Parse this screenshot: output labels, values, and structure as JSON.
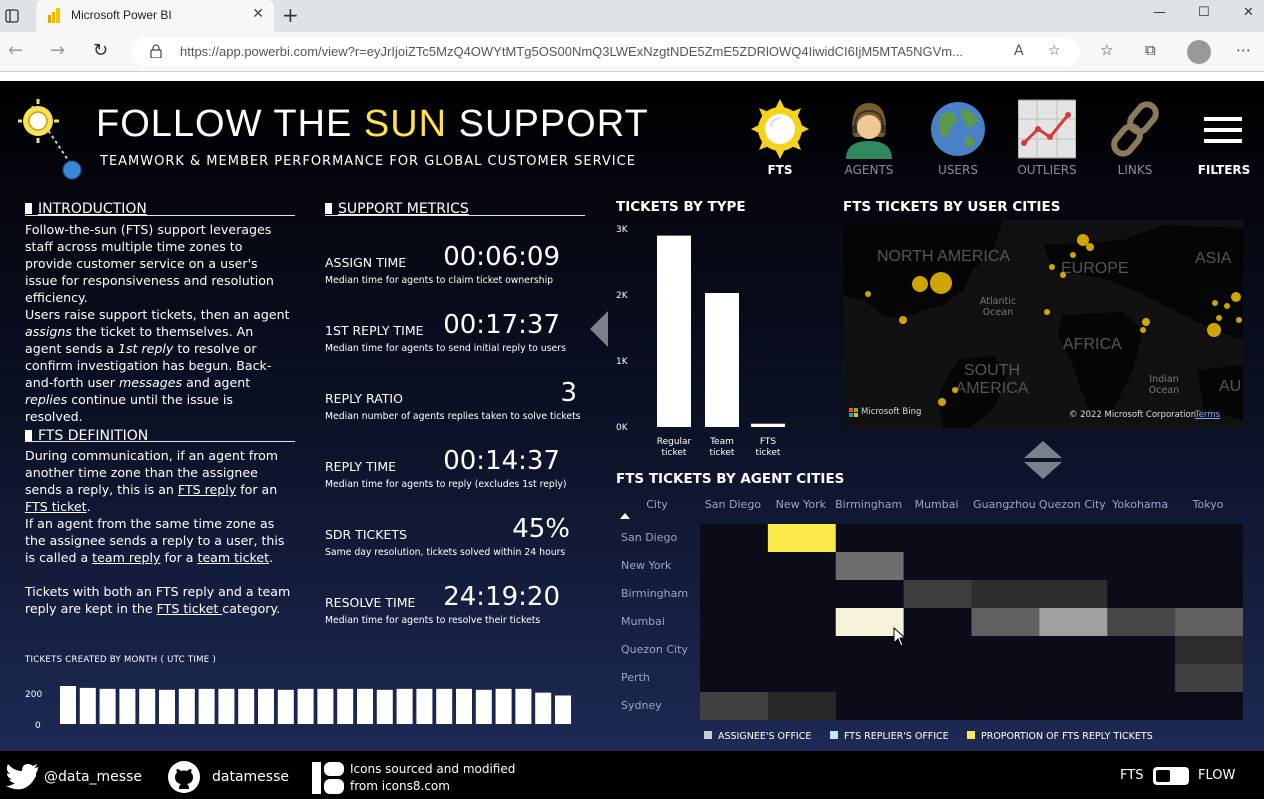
{
  "browser": {
    "tab_title": "Microsoft Power BI",
    "url": "https://app.powerbi.com/view?r=eyJrIjoiZTc5MzQ4OWYtMTg5OS00NmQ3LWExNzgtNDE5ZmE5ZDRlOWQ4IiwidCI6IjM5MTA5NGVm..."
  },
  "header": {
    "title_part1": "FOLLOW THE ",
    "title_sun": "SUN",
    "title_part2": " SUPPORT",
    "subtitle": "TEAMWORK & MEMBER PERFORMANCE FOR GLOBAL CUSTOMER SERVICE"
  },
  "nav": [
    {
      "label": "FTS",
      "icon": "sun-icon"
    },
    {
      "label": "AGENTS",
      "icon": "agent-icon"
    },
    {
      "label": "USERS",
      "icon": "globe-icon"
    },
    {
      "label": "OUTLIERS",
      "icon": "line-chart-icon"
    },
    {
      "label": "LINKS",
      "icon": "chain-link-icon"
    },
    {
      "label": "FILTERS",
      "icon": "hamburger-menu-icon"
    }
  ],
  "intro": {
    "heading": "INTRODUCTION",
    "p1": "Follow-the-sun (FTS) support leverages staff across multiple time zones to provide customer service on a user's issue for responsiveness and resolution efficiency.",
    "p2_a": "Users raise support tickets, then an agent ",
    "p2_b": "assigns",
    "p2_c": " the ticket to themselves. An agent sends a ",
    "p2_d": "1st reply",
    "p2_e": " to resolve or confirm investigation has begun. Back-and-forth user ",
    "p2_f": "messages",
    "p2_g": " and agent ",
    "p2_h": "replies",
    "p2_i": " continue until the issue is resolved."
  },
  "definition": {
    "heading": "FTS DEFINITION",
    "p1_a": "During communication, if an agent from another time zone than the assignee sends a reply, this is an ",
    "p1_b": "FTS reply",
    "p1_c": " for an ",
    "p1_d": "FTS ticket",
    "p1_e": ".",
    "p2_a": "If an agent from the same time zone as the assignee sends a reply to a user, this is called a ",
    "p2_b": "team reply",
    "p2_c": " for a ",
    "p2_d": "team ticket",
    "p2_e": ".",
    "p3_a": "Tickets with both an FTS reply and a team reply are kept in the ",
    "p3_b": "FTS ticket ",
    "p3_c": "category."
  },
  "metrics": {
    "heading": "SUPPORT METRICS",
    "items": [
      {
        "label": "ASSIGN TIME",
        "value": "00:06:09",
        "desc": "Median time for agents to claim ticket ownership"
      },
      {
        "label": "1ST REPLY TIME",
        "value": "00:17:37",
        "desc": "Median time for agents to send initial reply to users"
      },
      {
        "label": "REPLY RATIO",
        "value": "3",
        "desc": "Median number of agents replies taken to solve tickets"
      },
      {
        "label": "REPLY TIME",
        "value": "00:14:37",
        "desc": "Median time for agents to reply (excludes 1st reply)"
      },
      {
        "label": "SDR TICKETS",
        "value": "45%",
        "desc": "Same day resolution, tickets solved within 24 hours"
      },
      {
        "label": "RESOLVE TIME",
        "value": "24:19:20",
        "desc": "Median time for agents to resolve their tickets"
      }
    ]
  },
  "tickets_by_type_title": "TICKETS BY TYPE",
  "map": {
    "title": "FTS TICKETS BY USER CITIES",
    "labels": [
      "NORTH AMERICA",
      "EUROPE",
      "ASIA",
      "AFRICA",
      "SOUTH AMERICA",
      "AU"
    ],
    "ocean_labels": [
      "Atlantic Ocean",
      "Indian Ocean"
    ],
    "brand": "Microsoft Bing",
    "copyright": "© 2022 Microsoft Corporation",
    "terms": "Terms"
  },
  "heatmap_title": "FTS TICKETS BY AGENT CITIES",
  "heatmap_corner": "City",
  "legend": [
    {
      "label": "ASSIGNEE'S OFFICE",
      "color": "#c8ccd6"
    },
    {
      "label": "FTS REPLIER'S OFFICE",
      "color": "#bfe8f0"
    },
    {
      "label": "PROPORTION OF FTS REPLY TICKETS",
      "color": "#fce94a"
    }
  ],
  "monthly_title": "TICKETS CREATED BY MONTH   ( UTC TIME )",
  "footer": {
    "twitter": "@data_messe",
    "github": "datamesse",
    "icons_line1": "Icons sourced and modified",
    "icons_line2": "from icons8.com",
    "toggle_left": "FTS",
    "toggle_right": "FLOW"
  },
  "chart_data": [
    {
      "type": "bar",
      "title": "TICKETS BY TYPE",
      "categories": [
        "Regular ticket",
        "Team ticket",
        "FTS ticket"
      ],
      "values": [
        2900,
        2030,
        50
      ],
      "yticks": [
        "0K",
        "1K",
        "2K",
        "3K"
      ],
      "ylim": [
        0,
        3000
      ]
    },
    {
      "type": "heatmap",
      "title": "FTS TICKETS BY AGENT CITIES",
      "columns": [
        "San Diego",
        "New York",
        "Birmingham",
        "Mumbai",
        "Guangzhou",
        "Quezon City",
        "Yokohama",
        "Tokyo"
      ],
      "rows": [
        "San Diego",
        "New York",
        "Birmingham",
        "Mumbai",
        "Quezon City",
        "Perth",
        "Sydney"
      ],
      "values": [
        [
          0,
          1.0,
          0,
          0,
          0,
          0,
          0,
          0
        ],
        [
          0,
          0,
          0.45,
          0,
          0,
          0,
          0,
          0
        ],
        [
          0,
          0,
          0,
          0.2,
          0.12,
          0.12,
          0,
          0
        ],
        [
          0,
          0,
          0.95,
          0,
          0.38,
          0.7,
          0.25,
          0.38
        ],
        [
          0,
          0,
          0,
          0,
          0,
          0,
          0,
          0.12
        ],
        [
          0,
          0,
          0,
          0,
          0,
          0,
          0,
          0.22
        ],
        [
          0.22,
          0.1,
          0,
          0,
          0,
          0,
          0,
          0
        ]
      ],
      "highlight": [
        [
          0,
          1,
          "#fce94a"
        ],
        [
          3,
          2,
          "#f6f2d8"
        ]
      ]
    },
    {
      "type": "bar",
      "title": "TICKETS CREATED BY MONTH   ( UTC TIME )",
      "yticks": [
        "0",
        "200"
      ],
      "ylim": [
        0,
        200
      ],
      "values": [
        200,
        190,
        185,
        185,
        185,
        180,
        185,
        185,
        185,
        185,
        185,
        180,
        185,
        185,
        185,
        185,
        180,
        185,
        185,
        185,
        185,
        180,
        185,
        185,
        165,
        150
      ]
    }
  ]
}
